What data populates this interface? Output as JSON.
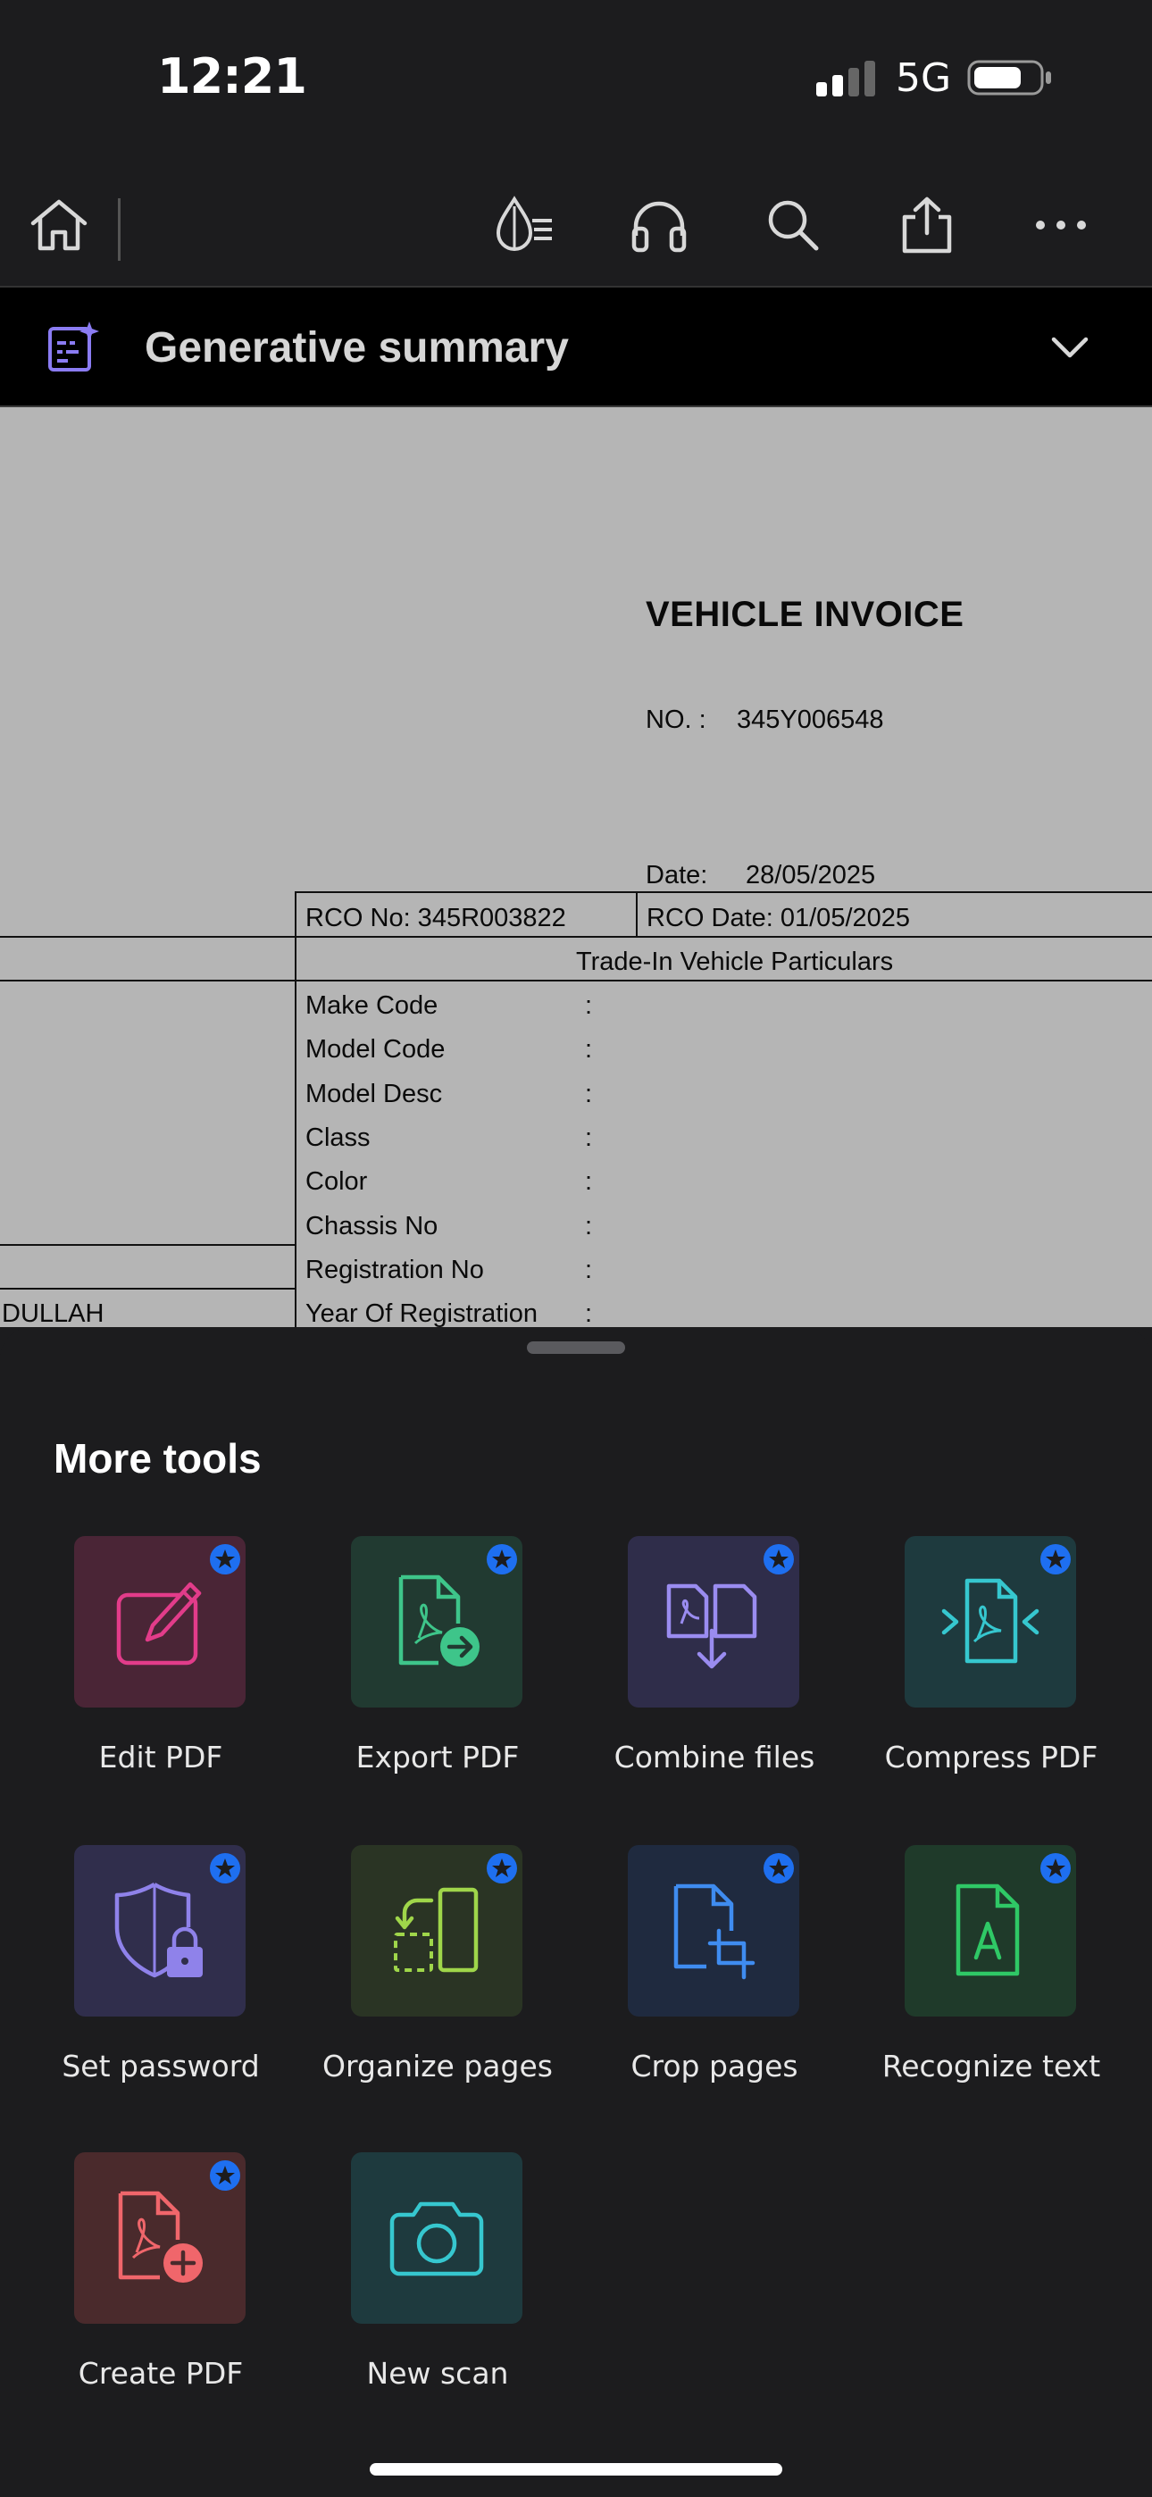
{
  "status_bar": {
    "time": "12:21",
    "network": "5G"
  },
  "toolbar": {
    "buttons": [
      "home-icon",
      "accessibility-reading-icon",
      "headphones-icon",
      "search-icon",
      "share-icon",
      "more-icon"
    ]
  },
  "summary": {
    "title": "Generative summary"
  },
  "document": {
    "heading": "VEHICLE INVOICE",
    "no_label": "NO. :",
    "no_value": "345Y006548",
    "date_label": "Date:",
    "date_value": "28/05/2025",
    "rco_no": "RCO No:  345R003822",
    "rco_date": "RCO Date: 01/05/2025",
    "section": "Trade-In Vehicle Particulars",
    "fields": [
      {
        "label": "Make Code",
        "sep": ":"
      },
      {
        "label": "Model Code",
        "sep": ":"
      },
      {
        "label": "Model Desc",
        "sep": ":"
      },
      {
        "label": "Class",
        "sep": ":"
      },
      {
        "label": "Color",
        "sep": ":"
      },
      {
        "label": "Chassis No",
        "sep": ":"
      },
      {
        "label": "Registration No",
        "sep": ":"
      },
      {
        "label": "Year Of Registration",
        "sep": ":"
      }
    ],
    "left_text": "DULLAH"
  },
  "sheet": {
    "title": "More tools",
    "tools": [
      {
        "label": "Edit PDF",
        "icon": "edit-pdf-icon",
        "bg": "#4a2536",
        "color": "#e23c8a"
      },
      {
        "label": "Export PDF",
        "icon": "export-pdf-icon",
        "bg": "#213a31",
        "color": "#3ec58a"
      },
      {
        "label": "Combine files",
        "icon": "combine-files-icon",
        "bg": "#2f2d4a",
        "color": "#9a8cf0"
      },
      {
        "label": "Compress PDF",
        "icon": "compress-pdf-icon",
        "bg": "#1e3a3e",
        "color": "#36c7cf"
      },
      {
        "label": "Set password",
        "icon": "set-password-icon",
        "bg": "#302e4c",
        "color": "#8f82ea"
      },
      {
        "label": "Organize pages",
        "icon": "organize-pages-icon",
        "bg": "#2a3424",
        "color": "#9fd64a"
      },
      {
        "label": "Crop pages",
        "icon": "crop-pages-icon",
        "bg": "#1f2a3f",
        "color": "#3f8cf0"
      },
      {
        "label": "Recognize text",
        "icon": "recognize-text-icon",
        "bg": "#1f3a2a",
        "color": "#2fc866"
      },
      {
        "label": "Create PDF",
        "icon": "create-pdf-icon",
        "bg": "#4a2a2c",
        "color": "#f0666b"
      },
      {
        "label": "New scan",
        "icon": "camera-icon",
        "bg": "#1e3a3e",
        "color": "#36c7cf"
      }
    ],
    "badge_color": "#1e6ff0"
  }
}
